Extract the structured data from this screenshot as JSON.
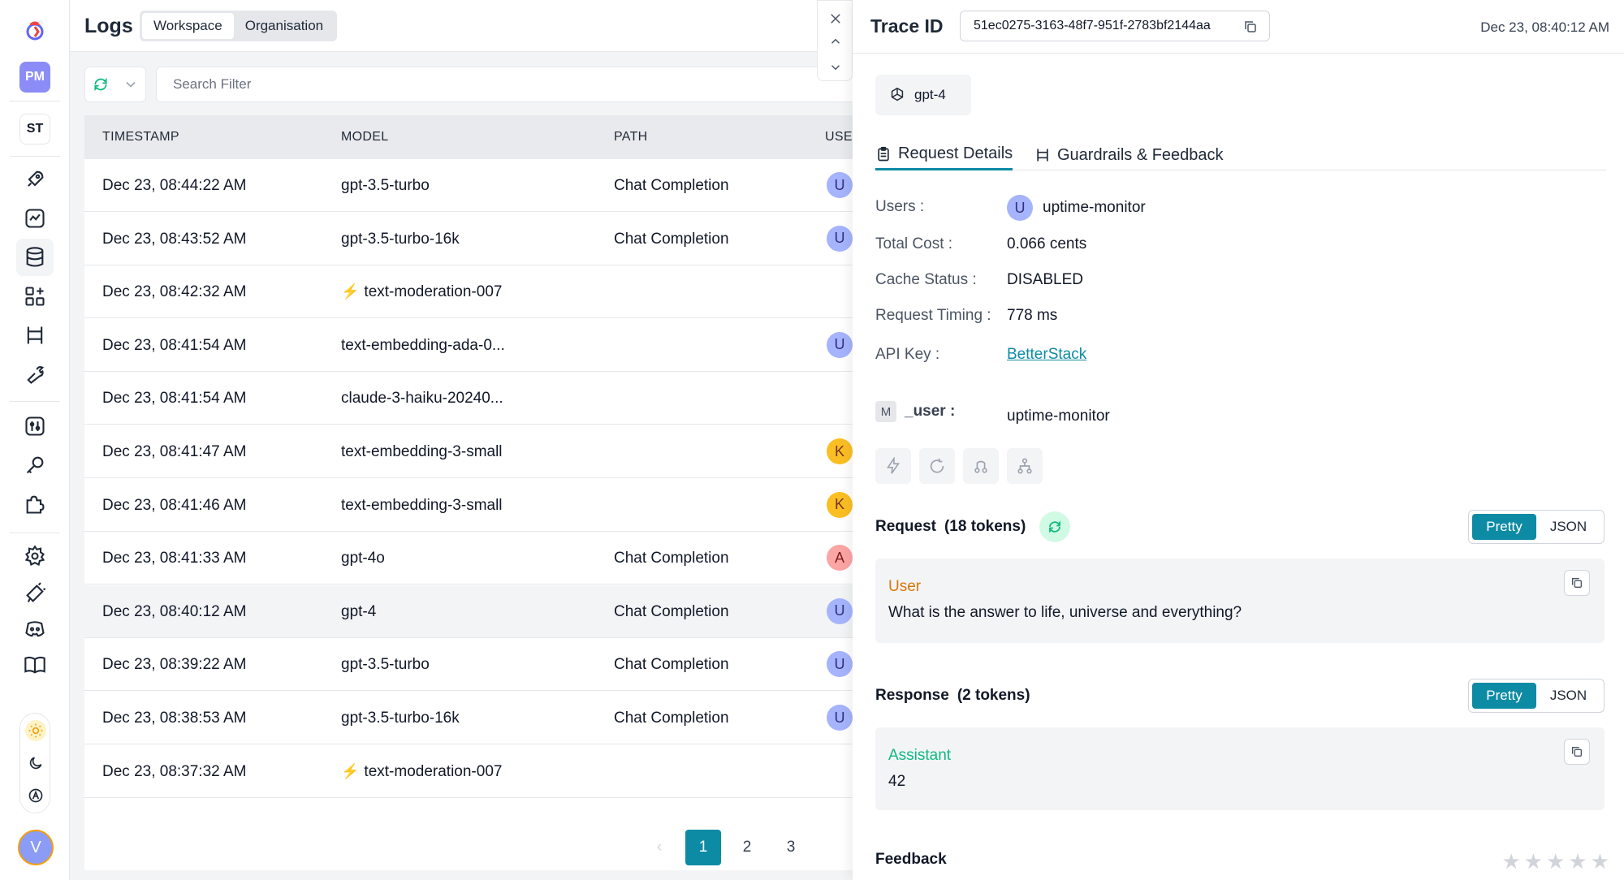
{
  "sidebar": {
    "workspace_badge": "PM",
    "org_badge": "ST",
    "user_avatar": "V"
  },
  "header": {
    "title": "Logs",
    "scope_options": [
      "Workspace",
      "Organisation"
    ]
  },
  "search": {
    "placeholder": "Search Filter"
  },
  "table": {
    "columns": [
      "TIMESTAMP",
      "MODEL",
      "PATH",
      "USER"
    ],
    "rows": [
      {
        "timestamp": "Dec 23, 08:44:22 AM",
        "model": "gpt-3.5-turbo",
        "path": "Chat Completion",
        "user": "U",
        "user_rest": "u",
        "bolt": false
      },
      {
        "timestamp": "Dec 23, 08:43:52 AM",
        "model": "gpt-3.5-turbo-16k",
        "path": "Chat Completion",
        "user": "U",
        "user_rest": "u",
        "bolt": false
      },
      {
        "timestamp": "Dec 23, 08:42:32 AM",
        "model": "text-moderation-007",
        "path": "",
        "user": "",
        "user_rest": "",
        "bolt": true
      },
      {
        "timestamp": "Dec 23, 08:41:54 AM",
        "model": "text-embedding-ada-0...",
        "path": "",
        "user": "U",
        "user_rest": "u",
        "bolt": false
      },
      {
        "timestamp": "Dec 23, 08:41:54 AM",
        "model": "claude-3-haiku-20240...",
        "path": "",
        "user": "",
        "user_rest": "",
        "bolt": false
      },
      {
        "timestamp": "Dec 23, 08:41:47 AM",
        "model": "text-embedding-3-small",
        "path": "",
        "user": "K",
        "user_rest": "k",
        "bolt": false
      },
      {
        "timestamp": "Dec 23, 08:41:46 AM",
        "model": "text-embedding-3-small",
        "path": "",
        "user": "K",
        "user_rest": "k",
        "bolt": false
      },
      {
        "timestamp": "Dec 23, 08:41:33 AM",
        "model": "gpt-4o",
        "path": "Chat Completion",
        "user": "A",
        "user_rest": "a",
        "bolt": false
      },
      {
        "timestamp": "Dec 23, 08:40:12 AM",
        "model": "gpt-4",
        "path": "Chat Completion",
        "user": "U",
        "user_rest": "u",
        "bolt": false
      },
      {
        "timestamp": "Dec 23, 08:39:22 AM",
        "model": "gpt-3.5-turbo",
        "path": "Chat Completion",
        "user": "U",
        "user_rest": "u",
        "bolt": false
      },
      {
        "timestamp": "Dec 23, 08:38:53 AM",
        "model": "gpt-3.5-turbo-16k",
        "path": "Chat Completion",
        "user": "U",
        "user_rest": "u",
        "bolt": false
      },
      {
        "timestamp": "Dec 23, 08:37:32 AM",
        "model": "text-moderation-007",
        "path": "",
        "user": "",
        "user_rest": "",
        "bolt": true
      }
    ],
    "selected_index": 8
  },
  "pagination": {
    "pages": [
      "1",
      "2",
      "3"
    ],
    "current": "1"
  },
  "drawer": {
    "trace_label": "Trace ID",
    "trace_id": "51ec0275-3163-48f7-951f-2783bf2144aa",
    "date": "Dec 23, 08:40:12 AM",
    "model": "gpt-4",
    "tabs": [
      "Request Details",
      "Guardrails & Feedback"
    ],
    "details": {
      "users_label": "Users :",
      "users_initial": "U",
      "users_value": "uptime-monitor",
      "cost_label": "Total Cost :",
      "cost_value": "0.066 cents",
      "cache_label": "Cache Status :",
      "cache_value": "DISABLED",
      "timing_label": "Request Timing :",
      "timing_value": "778 ms",
      "apikey_label": "API Key :",
      "apikey_value": "BetterStack",
      "meta_badge": "M",
      "meta_label": "_user :",
      "meta_value": "uptime-monitor"
    },
    "request": {
      "title": "Request",
      "tokens": "(18 tokens)",
      "role": "User",
      "text": "What is the answer to life, universe and everything?"
    },
    "response": {
      "title": "Response",
      "tokens": "(2 tokens)",
      "role": "Assistant",
      "text": "42"
    },
    "view_toggle": [
      "Pretty",
      "JSON"
    ],
    "feedback_title": "Feedback"
  },
  "colors": {
    "accent": "#0e8ba4",
    "user_role": "#d97706",
    "assistant_role": "#10b981",
    "avatar_u": "#a5b4fc",
    "avatar_k": "#fbbf24",
    "avatar_a": "#fca5a5"
  }
}
